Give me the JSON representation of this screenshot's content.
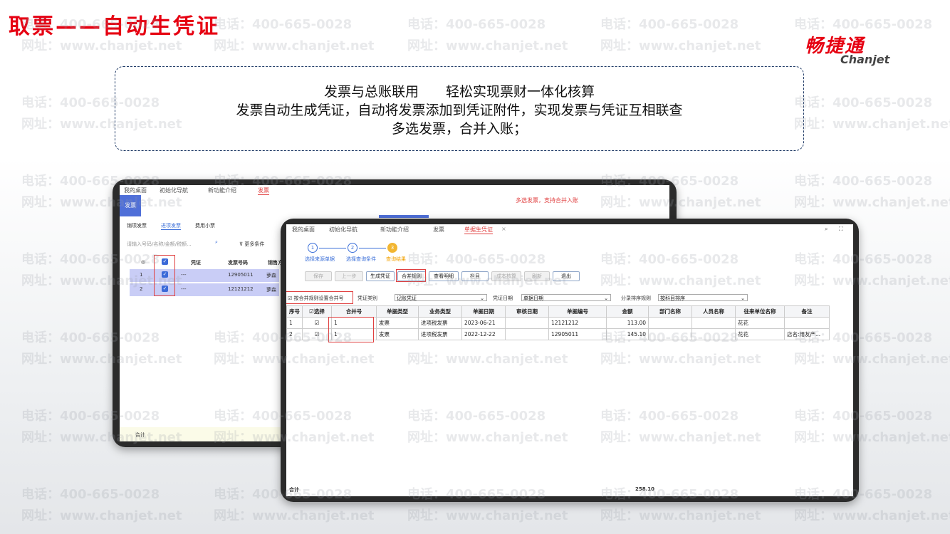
{
  "slide": {
    "title": "取票——自动生凭证",
    "logo_cn": "畅捷通",
    "logo_en": "Chanjet",
    "callout": [
      "发票与总账联用　　轻松实现票财一体化核算",
      "发票自动生成凭证，自动将发票添加到凭证附件，实现发票与凭证互相联查",
      "多选发票，合并入账；"
    ],
    "watermark_phone": "电话：400-665-0028",
    "watermark_site": "网址：www.chanjet.net",
    "accent": "#e60012"
  },
  "back_window": {
    "tabs": [
      "我的桌面",
      "初始化导航",
      "新功能介绍",
      "发票"
    ],
    "sidebar_label": "发票",
    "subtabs": [
      "销项发票",
      "进项发票",
      "费用小票"
    ],
    "search_placeholder": "请输入号码/名称/金额/税额...",
    "more_filters": "更多条件",
    "annotation": "多选发票，支持合并入账",
    "headers": [
      "凭证",
      "发票号码",
      "销售方"
    ],
    "rows": [
      {
        "no": "1",
        "voucher": "---",
        "invoice": "12905011",
        "seller": "萝森"
      },
      {
        "no": "2",
        "voucher": "---",
        "invoice": "12121212",
        "seller": "萝森"
      }
    ],
    "total_label": "合计"
  },
  "front_window": {
    "tabs": [
      "我的桌面",
      "初始化导航",
      "新功能介绍",
      "发票",
      "单据生凭证"
    ],
    "steps": [
      {
        "num": "1",
        "label": "选择来源单据"
      },
      {
        "num": "2",
        "label": "选择查询条件"
      },
      {
        "num": "3",
        "label": "查询结果"
      }
    ],
    "buttons": [
      "保存",
      "上一步",
      "生成凭证",
      "合并规则",
      "查看明细",
      "栏目",
      "成本核算",
      "刷新",
      "退出"
    ],
    "merge_checkbox": "按合并规则设置合并号",
    "voucher_type_label": "凭证类别",
    "voucher_type_value": "记账凭证",
    "voucher_date_label": "凭证日期",
    "voucher_date_value": "单据日期",
    "sort_rule_label": "分录排序规则",
    "sort_rule_value": "按科目排序",
    "columns": [
      "序号",
      "选择",
      "合并号",
      "单据类型",
      "业务类型",
      "单据日期",
      "审核日期",
      "单据编号",
      "金额",
      "部门名称",
      "人员名称",
      "往来单位名称",
      "备注"
    ],
    "rows": [
      {
        "no": "1",
        "merge": "1",
        "doc_type": "发票",
        "biz_type": "进项税发票",
        "date": "2023-06-21",
        "audit": "",
        "code": "12121212",
        "amount": "113.00",
        "dept": "",
        "person": "",
        "partner": "花花",
        "note": ""
      },
      {
        "no": "2",
        "merge": "1",
        "doc_type": "发票",
        "biz_type": "进项税发票",
        "date": "2022-12-22",
        "audit": "",
        "code": "12905011",
        "amount": "145.10",
        "dept": "",
        "person": "",
        "partner": "花花",
        "note": "店名:用友产..."
      }
    ],
    "total_label": "合计",
    "total_amount": "258.10"
  }
}
